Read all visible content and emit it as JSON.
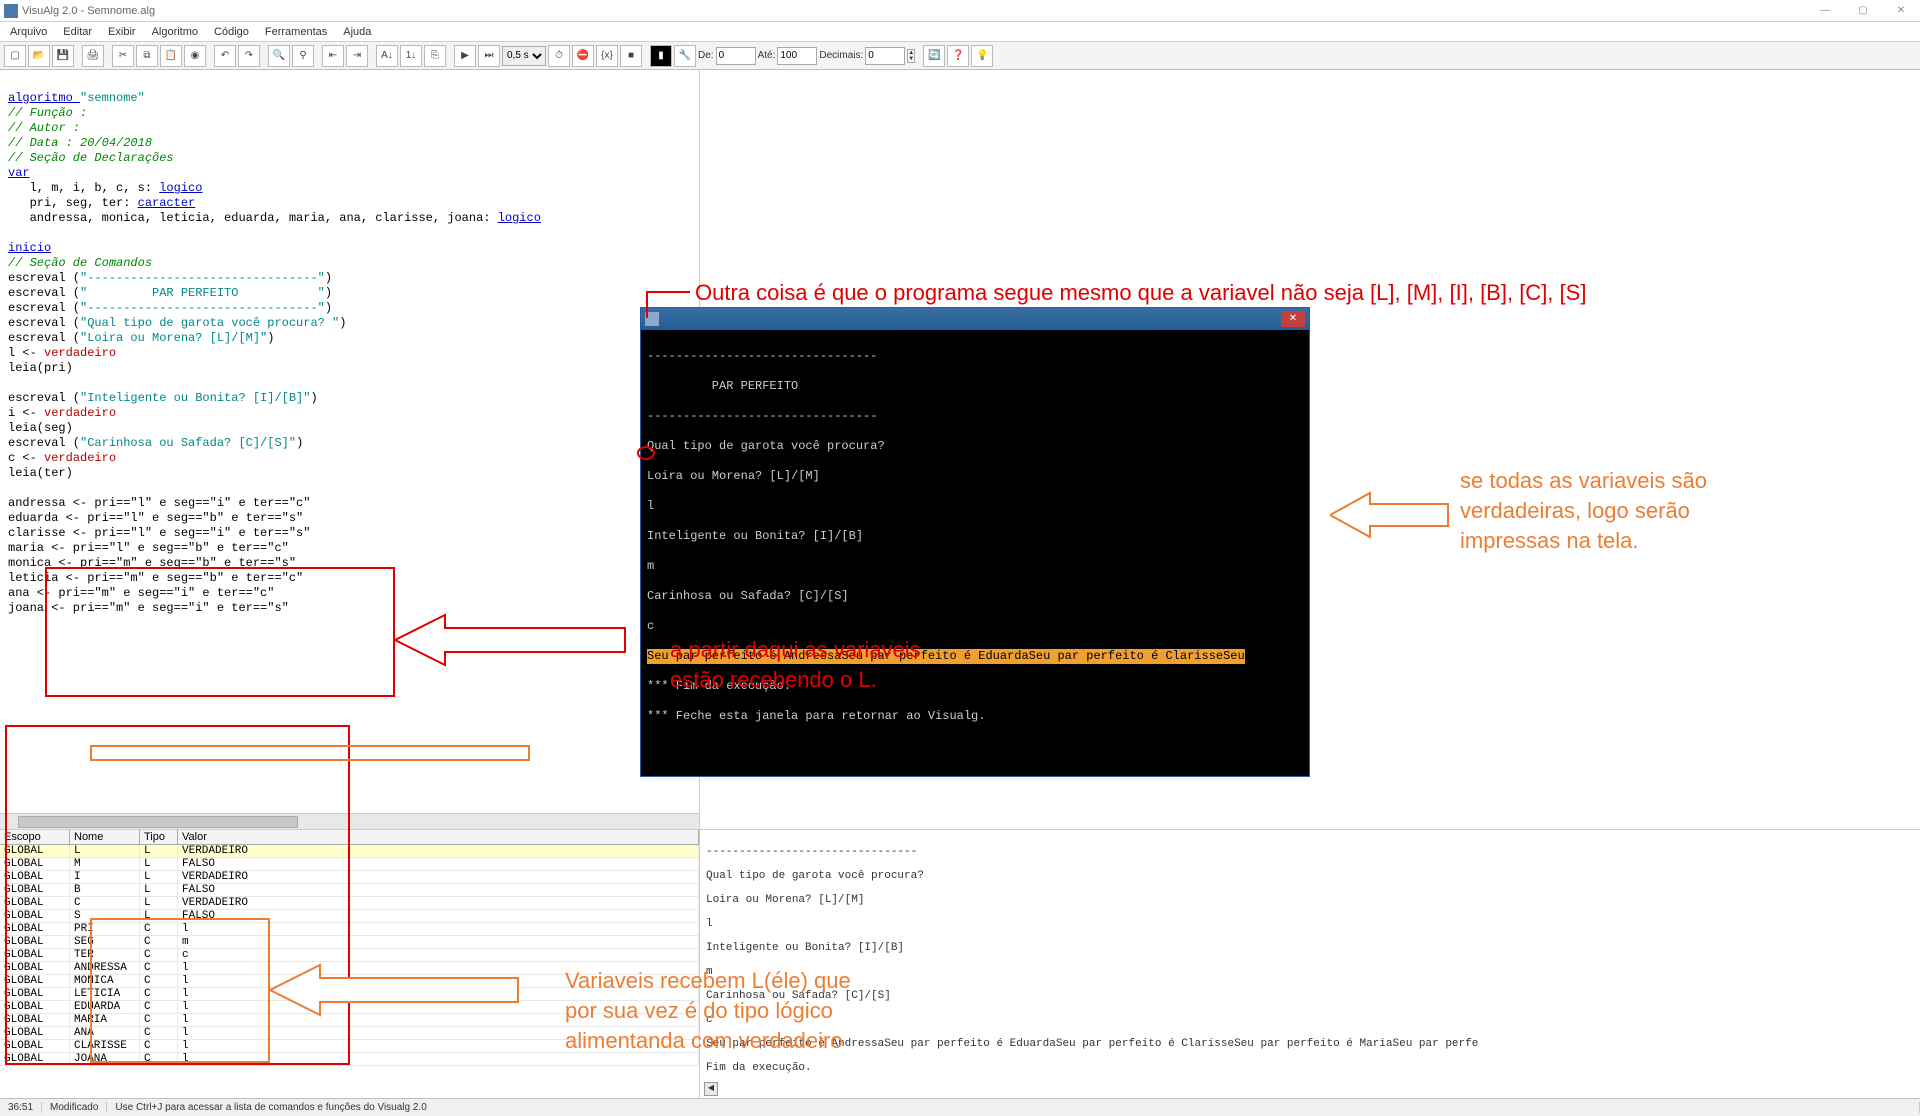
{
  "window": {
    "title": "VisuAlg 2.0 - Semnome.alg"
  },
  "menu": [
    "Arquivo",
    "Editar",
    "Exibir",
    "Algoritmo",
    "Código",
    "Ferramentas",
    "Ajuda"
  ],
  "toolbar": {
    "speed": "0,5 s",
    "de_label": "De:",
    "de_val": "0",
    "ate_label": "Até:",
    "ate_val": "100",
    "dec_label": "Decimais:",
    "dec_val": "0"
  },
  "code": {
    "l01a": "algoritmo ",
    "l01b": "\"semnome\"",
    "l02": "// Função :",
    "l03": "// Autor :",
    "l04": "// Data : 20/04/2018",
    "l05": "// Seção de Declarações",
    "l06": "var",
    "l07a": "   l, m, i, b, c, s: ",
    "l07b": "logico",
    "l08a": "   pri, seg, ter: ",
    "l08b": "caracter",
    "l09a": "   andressa, monica, leticia, eduarda, maria, ana, clarisse, joana: ",
    "l09b": "logico",
    "l10": "inicio",
    "l11": "// Seção de Comandos",
    "l12a": "escreval (",
    "l12b": "\"--------------------------------\"",
    "l12c": ")",
    "l13a": "escreval (",
    "l13b": "\"         PAR PERFEITO           \"",
    "l13c": ")",
    "l14a": "escreval (",
    "l14b": "\"--------------------------------\"",
    "l14c": ")",
    "l15a": "escreval (",
    "l15b": "\"Qual tipo de garota você procura? \"",
    "l15c": ")",
    "l16a": "escreval (",
    "l16b": "\"Loira ou Morena? [L]/[M]\"",
    "l16c": ")",
    "l17a": "l <- ",
    "l17b": "verdadeiro",
    "l18": "leia(pri)",
    "l19a": "escreval (",
    "l19b": "\"Inteligente ou Bonita? [I]/[B]\"",
    "l19c": ")",
    "l20a": "i <- ",
    "l20b": "verdadeiro",
    "l21": "leia(seg)",
    "l22a": "escreval (",
    "l22b": "\"Carinhosa ou Safada? [C]/[S]\"",
    "l22c": ")",
    "l23a": "c <- ",
    "l23b": "verdadeiro",
    "l24": "leia(ter)",
    "b1": "andressa <- pri==\"l\" e seg==\"i\" e ter==\"c\"",
    "b2": "eduarda <- pri==\"l\" e seg==\"b\" e ter==\"s\"",
    "b3": "clarisse <- pri==\"l\" e seg==\"i\" e ter==\"s\"",
    "b4": "maria <- pri==\"l\" e seg==\"b\" e ter==\"c\"",
    "b5": "monica <- pri==\"m\" e seg==\"b\" e ter==\"s\"",
    "b6": "leticia <- pri==\"m\" e seg==\"b\" e ter==\"c\"",
    "b7": "ana <- pri==\"m\" e seg==\"i\" e ter==\"c\"",
    "b8": "joana <- pri==\"m\" e seg==\"i\" e ter==\"s\""
  },
  "vartable": {
    "cols": {
      "escopo": "Escopo",
      "nome": "Nome",
      "tipo": "Tipo",
      "valor": "Valor"
    },
    "rows": [
      {
        "e": "GLOBAL",
        "n": "L",
        "t": "L",
        "v": "VERDADEIRO"
      },
      {
        "e": "GLOBAL",
        "n": "M",
        "t": "L",
        "v": "FALSO"
      },
      {
        "e": "GLOBAL",
        "n": "I",
        "t": "L",
        "v": "VERDADEIRO"
      },
      {
        "e": "GLOBAL",
        "n": "B",
        "t": "L",
        "v": "FALSO"
      },
      {
        "e": "GLOBAL",
        "n": "C",
        "t": "L",
        "v": "VERDADEIRO"
      },
      {
        "e": "GLOBAL",
        "n": "S",
        "t": "L",
        "v": "FALSO"
      },
      {
        "e": "GLOBAL",
        "n": "PRI",
        "t": "C",
        "v": "l"
      },
      {
        "e": "GLOBAL",
        "n": "SEG",
        "t": "C",
        "v": "m"
      },
      {
        "e": "GLOBAL",
        "n": "TER",
        "t": "C",
        "v": "c"
      },
      {
        "e": "GLOBAL",
        "n": "ANDRESSA",
        "t": "C",
        "v": "l"
      },
      {
        "e": "GLOBAL",
        "n": "MONICA",
        "t": "C",
        "v": "l"
      },
      {
        "e": "GLOBAL",
        "n": "LETICIA",
        "t": "C",
        "v": "l"
      },
      {
        "e": "GLOBAL",
        "n": "EDUARDA",
        "t": "C",
        "v": "l"
      },
      {
        "e": "GLOBAL",
        "n": "MARIA",
        "t": "C",
        "v": "l"
      },
      {
        "e": "GLOBAL",
        "n": "ANA",
        "t": "C",
        "v": "l"
      },
      {
        "e": "GLOBAL",
        "n": "CLARISSE",
        "t": "C",
        "v": "l"
      },
      {
        "e": "GLOBAL",
        "n": "JOANA",
        "t": "C",
        "v": "l"
      }
    ]
  },
  "console": {
    "l1": "--------------------------------",
    "l2": "         PAR PERFEITO",
    "l3": "--------------------------------",
    "l4": "Qual tipo de garota você procura?",
    "l5": "Loira ou Morena? [L]/[M]",
    "l6": "l",
    "l7": "Inteligente ou Bonita? [I]/[B]",
    "l8": "m",
    "l9": "Carinhosa ou Safada? [C]/[S]",
    "l10": "c",
    "l11": "Seu par perfeito é AndressaSeu par perfeito é EduardaSeu par perfeito é ClarisseSeu",
    "l12": "*** Fim da execução.",
    "l13": "*** Feche esta janela para retornar ao Visualg."
  },
  "output": {
    "l0": "--------------------------------",
    "l1": "Qual tipo de garota você procura?",
    "l2": "Loira ou Morena? [L]/[M]",
    "l3": "l",
    "l4": "Inteligente ou Bonita? [I]/[B]",
    "l5": "m",
    "l6": "Carinhosa ou Safada? [C]/[S]",
    "l7": "c",
    "l8": "Seu par perfeito é AndressaSeu par perfeito é EduardaSeu par perfeito é ClarisseSeu par perfeito é MariaSeu par perfe",
    "l9": "Fim da execução."
  },
  "annotations": {
    "top": "Outra coisa é que o programa segue mesmo que a variavel não seja [L], [M], [I], [B], [C], [S]",
    "mid1": "a partir daqui as variaveis",
    "mid2": "estão recebendo o L.",
    "right1": "se todas as variaveis são",
    "right2": "verdadeiras, logo serão",
    "right3": "impressas na tela.",
    "bot1": "Variaveis recebem L(éle) que",
    "bot2": "por sua vez é do tipo lógico",
    "bot3": "alimentanda com verdadeiro"
  },
  "status": {
    "pos": "36:51",
    "mod": "Modificado",
    "hint": "Use Ctrl+J para acessar a lista de comandos e funções do Visualg 2.0"
  }
}
